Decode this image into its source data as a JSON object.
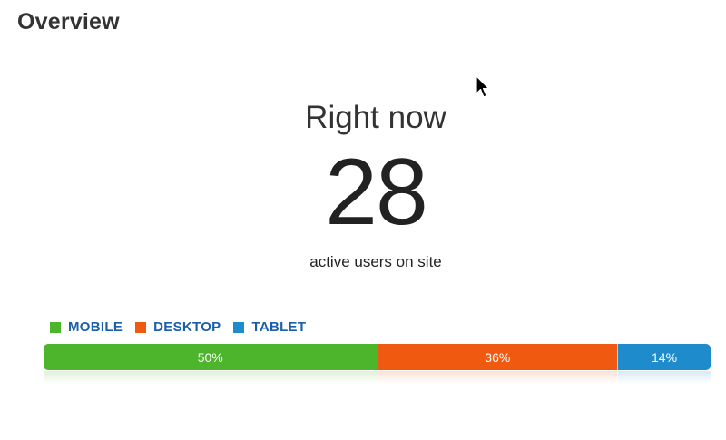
{
  "header": {
    "title": "Overview"
  },
  "realtime": {
    "label": "Right now",
    "count": "28",
    "sublabel": "active users on site"
  },
  "legend": [
    {
      "label": "MOBILE",
      "color": "#4cb52b"
    },
    {
      "label": "DESKTOP",
      "color": "#f05a10"
    },
    {
      "label": "TABLET",
      "color": "#1e8bcc"
    }
  ],
  "breakdown": [
    {
      "segment": "MOBILE",
      "percent": 50,
      "label": "50%",
      "color": "#4cb52b"
    },
    {
      "segment": "DESKTOP",
      "percent": 36,
      "label": "36%",
      "color": "#f05a10"
    },
    {
      "segment": "TABLET",
      "percent": 14,
      "label": "14%",
      "color": "#1e8bcc"
    }
  ],
  "icons": {
    "cursor": "mouse-pointer-icon"
  }
}
